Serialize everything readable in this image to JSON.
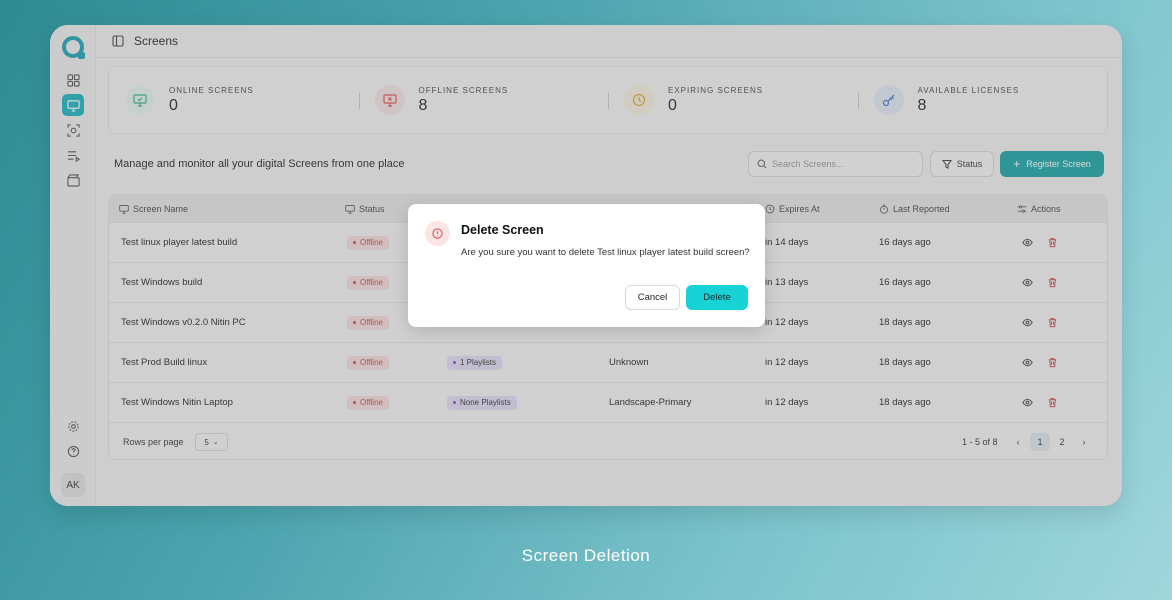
{
  "window_title": "Screens",
  "user_initials": "AK",
  "stats": [
    {
      "label": "ONLINE SCREENS",
      "value": "0",
      "icon": "monitor-check-icon",
      "color": "#2bb58a"
    },
    {
      "label": "OFFLINE SCREENS",
      "value": "8",
      "icon": "monitor-x-icon",
      "color": "#e05252"
    },
    {
      "label": "EXPIRING SCREENS",
      "value": "0",
      "icon": "clock-icon",
      "color": "#e0a92a"
    },
    {
      "label": "AVAILABLE LICENSES",
      "value": "8",
      "icon": "key-icon",
      "color": "#3a78d6"
    }
  ],
  "toolbar": {
    "description": "Manage and monitor all your digital Screens from one place",
    "search_placeholder": "Search Screens...",
    "status_label": "Status",
    "register_label": "Register Screen"
  },
  "table": {
    "headers": [
      "Screen Name",
      "Status",
      "Expires At",
      "Last Reported",
      "Actions"
    ],
    "rows": [
      {
        "name": "Test linux player latest build",
        "status": "Offline",
        "playlist": "",
        "orientation": "",
        "expires": "in 14 days",
        "reported": "16 days ago"
      },
      {
        "name": "Test Windows build",
        "status": "Offline",
        "playlist": "",
        "orientation": "",
        "expires": "in 13 days",
        "reported": "16 days ago"
      },
      {
        "name": "Test Windows v0.2.0 Nitin PC",
        "status": "Offline",
        "playlist": "",
        "orientation": "",
        "expires": "in 12 days",
        "reported": "18 days ago"
      },
      {
        "name": "Test Prod Build linux",
        "status": "Offline",
        "playlist": "1 Playlists",
        "orientation": "Unknown",
        "expires": "in 12 days",
        "reported": "18 days ago"
      },
      {
        "name": "Test Windows Nitin Laptop",
        "status": "Offline",
        "playlist": "None Playlists",
        "orientation": "Landscape-Primary",
        "expires": "in 12 days",
        "reported": "18 days ago"
      }
    ],
    "rows_per_page_label": "Rows per page",
    "rows_per_page_value": "5",
    "range_label": "1 - 5 of 8",
    "pages": [
      "1",
      "2"
    ]
  },
  "dialog": {
    "title": "Delete Screen",
    "message": "Are you sure you want to delete Test linux player latest build screen?",
    "cancel_label": "Cancel",
    "delete_label": "Delete"
  },
  "caption": "Screen Deletion"
}
